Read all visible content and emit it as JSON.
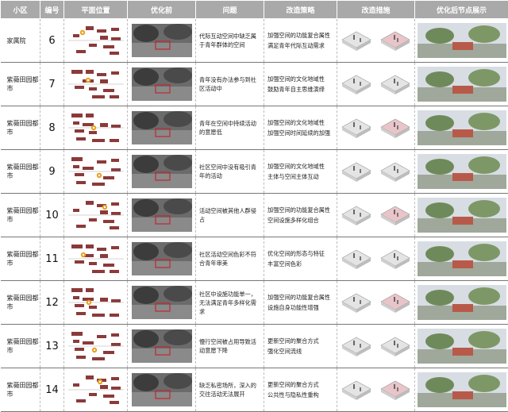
{
  "headers": {
    "district": "小区",
    "number": "编号",
    "plan_location": "平面位置",
    "before": "优化前",
    "problem": "问题",
    "strategy": "改造策略",
    "measures": "改造措施",
    "after": "优化后节点展示"
  },
  "rows": [
    {
      "district": "家属院",
      "number": "6",
      "problem": "代际互动空间中缺乏属于青年群体的空间",
      "strategy_1": "加强空间的功能复合属性",
      "strategy_2": "满足青年代际互动需求"
    },
    {
      "district": "紫薇田园都市",
      "number": "7",
      "problem": "青年没有办法参与到社区活动中",
      "strategy_1": "加强空间的文化地域性",
      "strategy_2": "鼓励青年自主思维演绎"
    },
    {
      "district": "紫薇田园都市",
      "number": "8",
      "problem": "青年在空间中持续活动的意愿低",
      "strategy_1": "加强空间的文化地域性",
      "strategy_2": "加强空间时间延续的加强"
    },
    {
      "district": "紫薇田园都市",
      "number": "9",
      "problem": "社区空间中没有吸引青年的活动",
      "strategy_1": "加强空间的文化地域性",
      "strategy_2": "主体与空间主体互动"
    },
    {
      "district": "紫薇田园都市",
      "number": "10",
      "problem": "活动空间被其他人群侵占",
      "strategy_1": "加强空间的功能复合属性",
      "strategy_2": "空间设施多样化组合"
    },
    {
      "district": "紫薇田园都市",
      "number": "11",
      "problem": "社区活动空间色彩不符合青年审美",
      "strategy_1": "优化空间的形态与特征",
      "strategy_2": "丰富空间色彩"
    },
    {
      "district": "紫薇田园都市",
      "number": "12",
      "problem": "社区中设施功能单一，无法满足青年多样化需求",
      "strategy_1": "加强空间的功能复合属性",
      "strategy_2": "设施自身功能性增强"
    },
    {
      "district": "紫薇田园都市",
      "number": "13",
      "problem": "慢行空间被占用导致活动意愿下降",
      "strategy_1": "更新空间的聚合方式",
      "strategy_2": "强化空间流线"
    },
    {
      "district": "紫薇田园都市",
      "number": "14",
      "problem": "缺乏私密场所，深入的交往活动无法展开",
      "strategy_1": "更新空间的聚合方式",
      "strategy_2": "公共性与隐私性重构"
    }
  ],
  "colors": {
    "header_bg": "#a9a9a9",
    "building": "#8b3a3a",
    "marker": "#e8a020",
    "iso_pink": "#e9c4c8",
    "iso_grey": "#e4e4e4"
  }
}
